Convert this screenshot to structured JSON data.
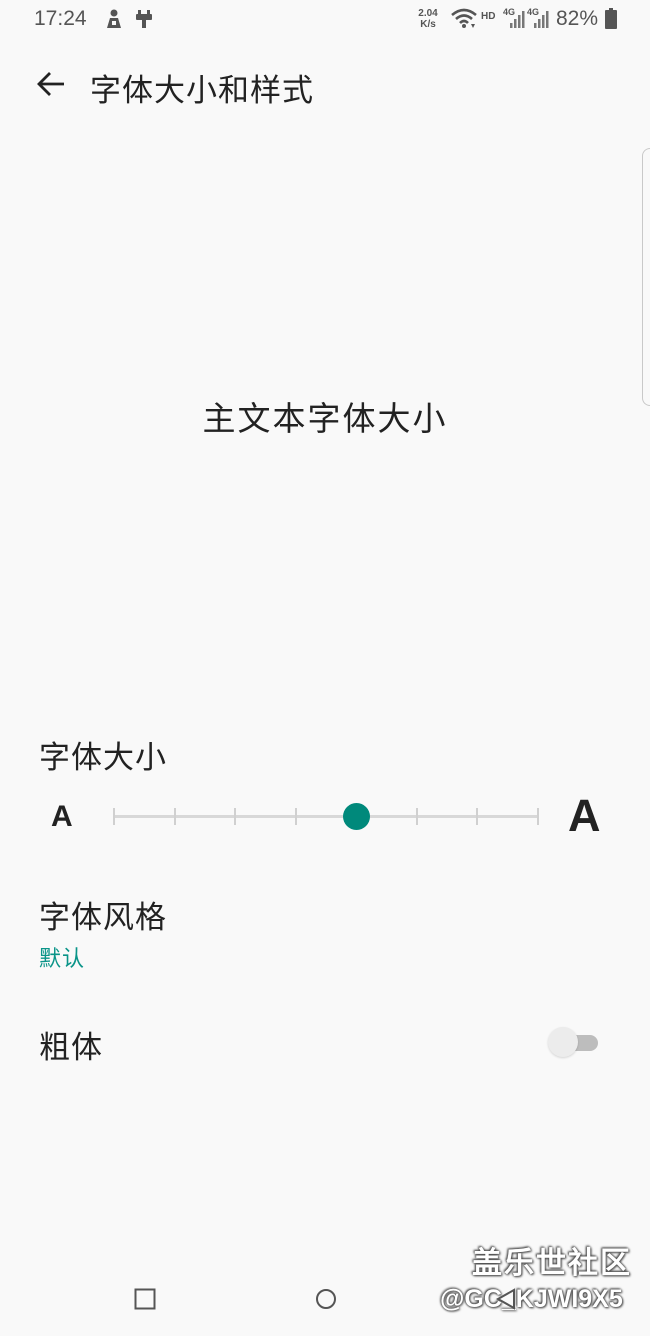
{
  "status_bar": {
    "time": "17:24",
    "net_speed_value": "2.04",
    "net_speed_unit": "K/s",
    "hd_label": "HD",
    "network_labels": [
      "4G",
      "4G"
    ],
    "battery_percent": "82%",
    "icons": [
      "notification-app-icon",
      "notification-usb-icon",
      "wifi-icon",
      "signal-icon",
      "signal-icon",
      "battery-icon"
    ]
  },
  "toolbar": {
    "back_icon": "arrow-back-icon",
    "title": "字体大小和样式"
  },
  "preview": {
    "text": "主文本字体大小"
  },
  "font_size": {
    "label": "字体大小",
    "small_glyph": "A",
    "large_glyph": "A",
    "steps": 8,
    "selected_index": 4,
    "accent_color": "#00897b"
  },
  "font_style": {
    "label": "字体风格",
    "value": "默认",
    "value_color": "#0a9488"
  },
  "bold": {
    "label": "粗体",
    "enabled": false
  },
  "watermark": {
    "site": "盖乐世社区",
    "user": "@GC_KJWI9X5"
  },
  "nav_bar": {
    "buttons": [
      "recent-apps-icon",
      "home-icon",
      "back-icon"
    ]
  }
}
